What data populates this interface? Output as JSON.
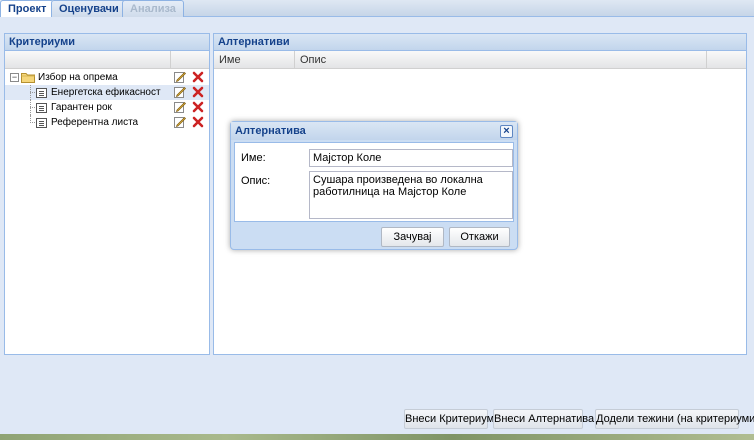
{
  "tabs": [
    {
      "label": "Проект"
    },
    {
      "label": "Оценувачи"
    },
    {
      "label": "Анализа"
    }
  ],
  "criteria_panel": {
    "title": "Критериуми",
    "root": {
      "label": "Избор на опрема",
      "icon": "folder-icon"
    },
    "children": [
      {
        "label": "Енергетска ефикасност"
      },
      {
        "label": "Гарантен рок"
      },
      {
        "label": "Референтна листа"
      }
    ],
    "row_actions": [
      "edit-icon",
      "delete-icon"
    ]
  },
  "alternatives_panel": {
    "title": "Алтернативи",
    "columns": [
      "Име",
      "Опис"
    ]
  },
  "dialog": {
    "title": "Алтернатива",
    "close_icon": "close-icon",
    "name_label": "Име:",
    "name_value": "Мајстор Коле",
    "description_label": "Опис:",
    "description_value": "Сушара произведена во локална работилница на Мајстор Коле",
    "save_label": "Зачувај",
    "cancel_label": "Откажи"
  },
  "bottom_buttons": {
    "add_criteria": "Внеси Критериум",
    "add_alternative": "Внеси Алтернатива",
    "assign_weights": "Додели тежини (на критериуми)"
  },
  "colors": {
    "header_text": "#15428b",
    "border": "#99bbe8",
    "delete": "#cc2222"
  }
}
